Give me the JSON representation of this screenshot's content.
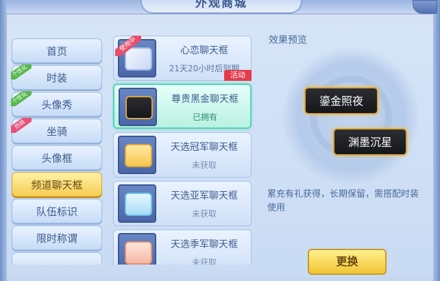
{
  "window": {
    "title": "外观商城"
  },
  "sidebar": {
    "items": [
      {
        "label": "首页",
        "ribbon": ""
      },
      {
        "label": "时装",
        "ribbon": "个性化"
      },
      {
        "label": "头像秀",
        "ribbon": "个性化"
      },
      {
        "label": "坐骑",
        "ribbon": "热销"
      },
      {
        "label": "头像框",
        "ribbon": ""
      },
      {
        "label": "频道聊天框",
        "ribbon": "",
        "active": true
      },
      {
        "label": "队伍标识",
        "ribbon": ""
      },
      {
        "label": "限时称谓",
        "ribbon": ""
      },
      {
        "label": "",
        "ribbon": ""
      }
    ]
  },
  "list": {
    "items": [
      {
        "name": "心恋聊天框",
        "status": "21天20小时后到期",
        "tag": "使用中",
        "badge": "活动"
      },
      {
        "name": "尊贵黑金聊天框",
        "status": "已拥有",
        "selected": true
      },
      {
        "name": "天选冠军聊天框",
        "status": "未获取"
      },
      {
        "name": "天选亚军聊天框",
        "status": "未获取"
      },
      {
        "name": "天选季军聊天框",
        "status": "未获取"
      }
    ]
  },
  "preview": {
    "title": "效果预览",
    "bubbles": [
      "鎏金照夜",
      "渊墨沉星"
    ],
    "description": "累充有礼获得，长期保留，需搭配时装使用",
    "button": "更换"
  },
  "colors": {
    "accent": "#f6cd52",
    "selected": "#54d3b7",
    "event": "#e43b4c",
    "text": "#3d5a8c"
  }
}
